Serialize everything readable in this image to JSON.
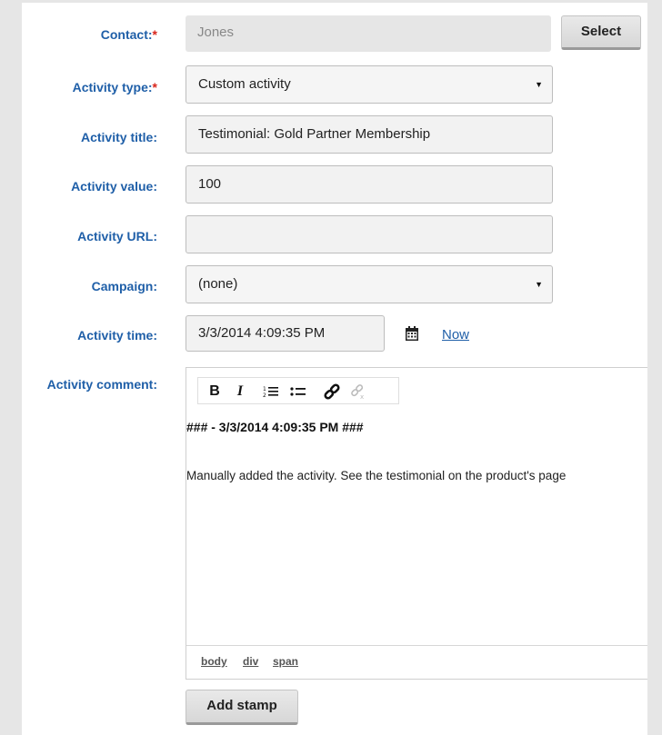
{
  "form": {
    "contact": {
      "label": "Contact:",
      "required_mark": "*",
      "value": "Jones",
      "select_button": "Select"
    },
    "activity_type": {
      "label": "Activity type:",
      "required_mark": "*",
      "value": "Custom activity"
    },
    "activity_title": {
      "label": "Activity title:",
      "value": "Testimonial: Gold Partner Membership"
    },
    "activity_value": {
      "label": "Activity value:",
      "value": "100"
    },
    "activity_url": {
      "label": "Activity URL:",
      "value": ""
    },
    "campaign": {
      "label": "Campaign:",
      "value": "(none)"
    },
    "activity_time": {
      "label": "Activity time:",
      "value": "3/3/2014 4:09:35 PM",
      "now_link": "Now"
    },
    "activity_comment": {
      "label": "Activity comment:",
      "toolbar": {
        "bold": "B",
        "italic": "I"
      },
      "stamp_line": "### - 3/3/2014 4:09:35 PM ###",
      "comment_text": "Manually added the activity. See the testimonial on the product's page",
      "path": [
        "body",
        "div",
        "span"
      ]
    },
    "add_stamp_button": "Add stamp"
  },
  "colors": {
    "label": "#1f5fa8",
    "required": "#d9261c",
    "page_bg": "#e6e6e6"
  },
  "icons": [
    "calendar-icon",
    "bold-icon",
    "italic-icon",
    "numbered-list-icon",
    "bulleted-list-icon",
    "link-icon",
    "unlink-icon",
    "dropdown-caret-icon"
  ]
}
